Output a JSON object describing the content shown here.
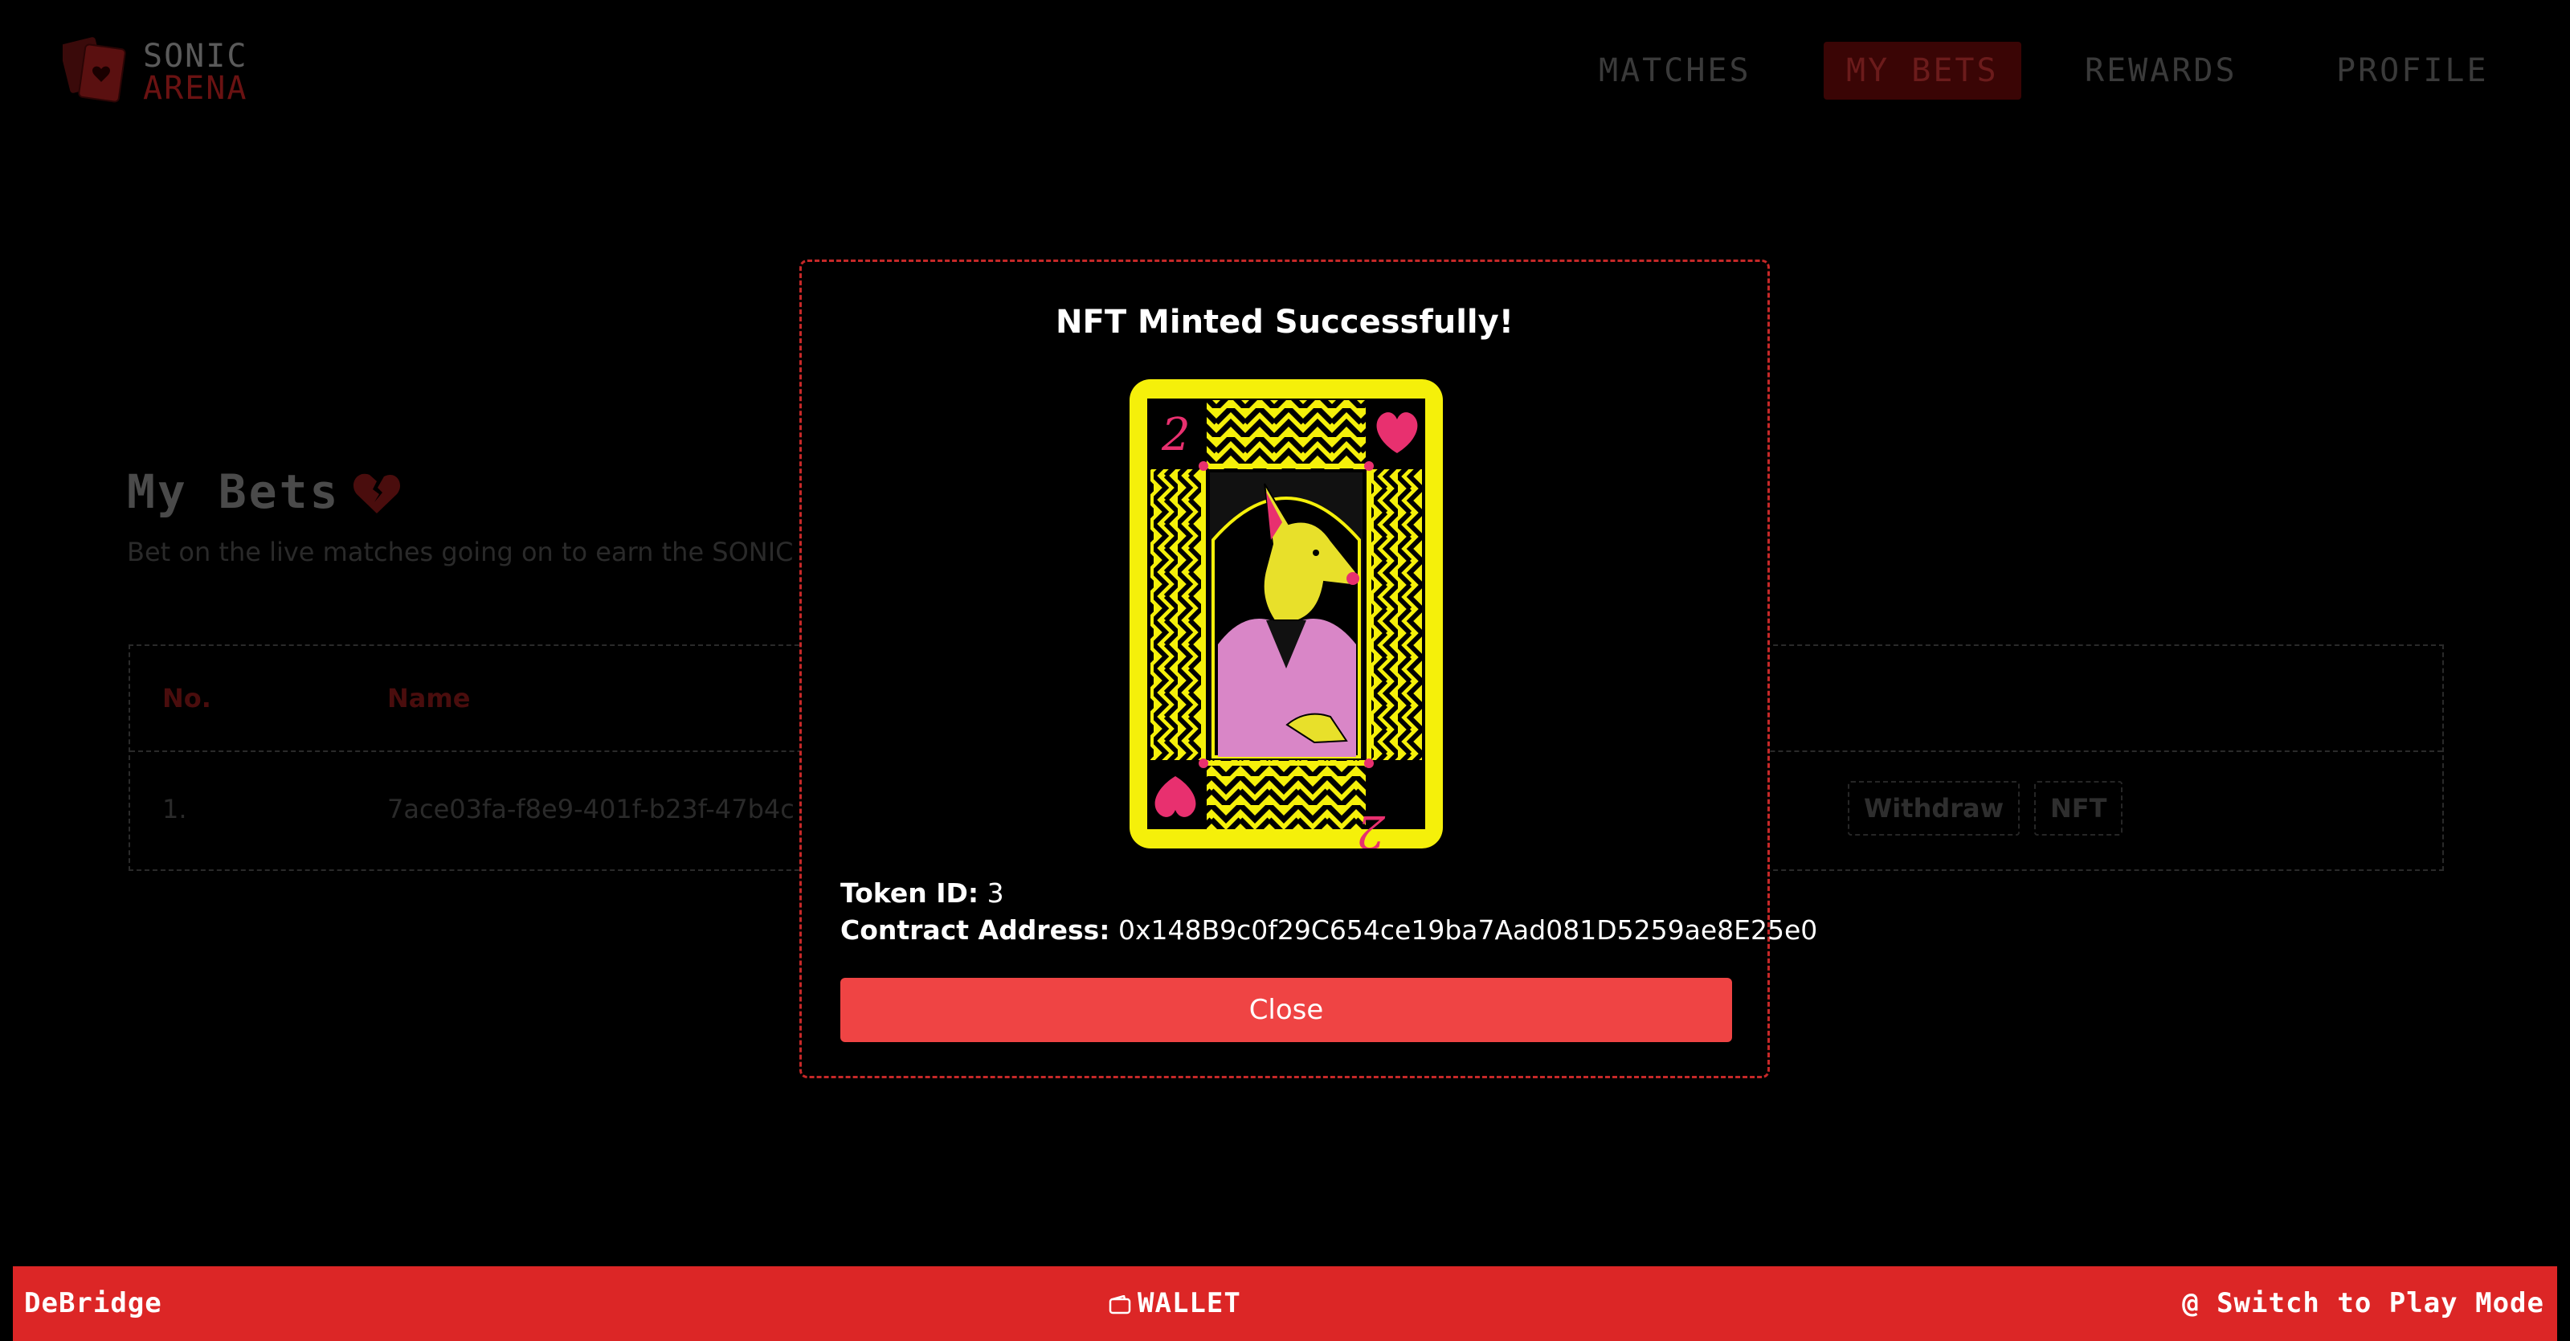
{
  "header": {
    "logo": {
      "line1": "SONIC",
      "line2": "ARENA"
    },
    "nav": [
      {
        "label": "MATCHES",
        "active": false
      },
      {
        "label": "MY BETS",
        "active": true
      },
      {
        "label": "REWARDS",
        "active": false
      },
      {
        "label": "PROFILE",
        "active": false
      }
    ]
  },
  "page": {
    "title": "My Bets",
    "subtitle": "Bet on the live matches going on to earn the SONIC c",
    "table": {
      "headers": [
        "No.",
        "Name"
      ],
      "rows": [
        {
          "no": "1.",
          "name": "7ace03fa-f8e9-401f-b23f-47b4c",
          "actions": [
            "Withdraw",
            "NFT"
          ]
        }
      ]
    }
  },
  "modal": {
    "title": "NFT Minted Successfully!",
    "token_id_label": "Token ID:",
    "token_id": "3",
    "contract_label": "Contract Address:",
    "contract_address": "0x148B9c0f29C654ce19ba7Aad081D5259ae8E25e0",
    "close_label": "Close",
    "card": {
      "rank": "2",
      "suit": "hearts",
      "character": "dog-in-pink-suit"
    }
  },
  "bottom_bar": {
    "left": "DeBridge",
    "center": "WALLET",
    "right": "@ Switch to Play Mode"
  },
  "colors": {
    "accent_red": "#dc2626",
    "close_button": "#ef4444",
    "modal_border": "#c62828",
    "card_yellow": "#f5f00a",
    "card_pink": "#e8306f"
  }
}
